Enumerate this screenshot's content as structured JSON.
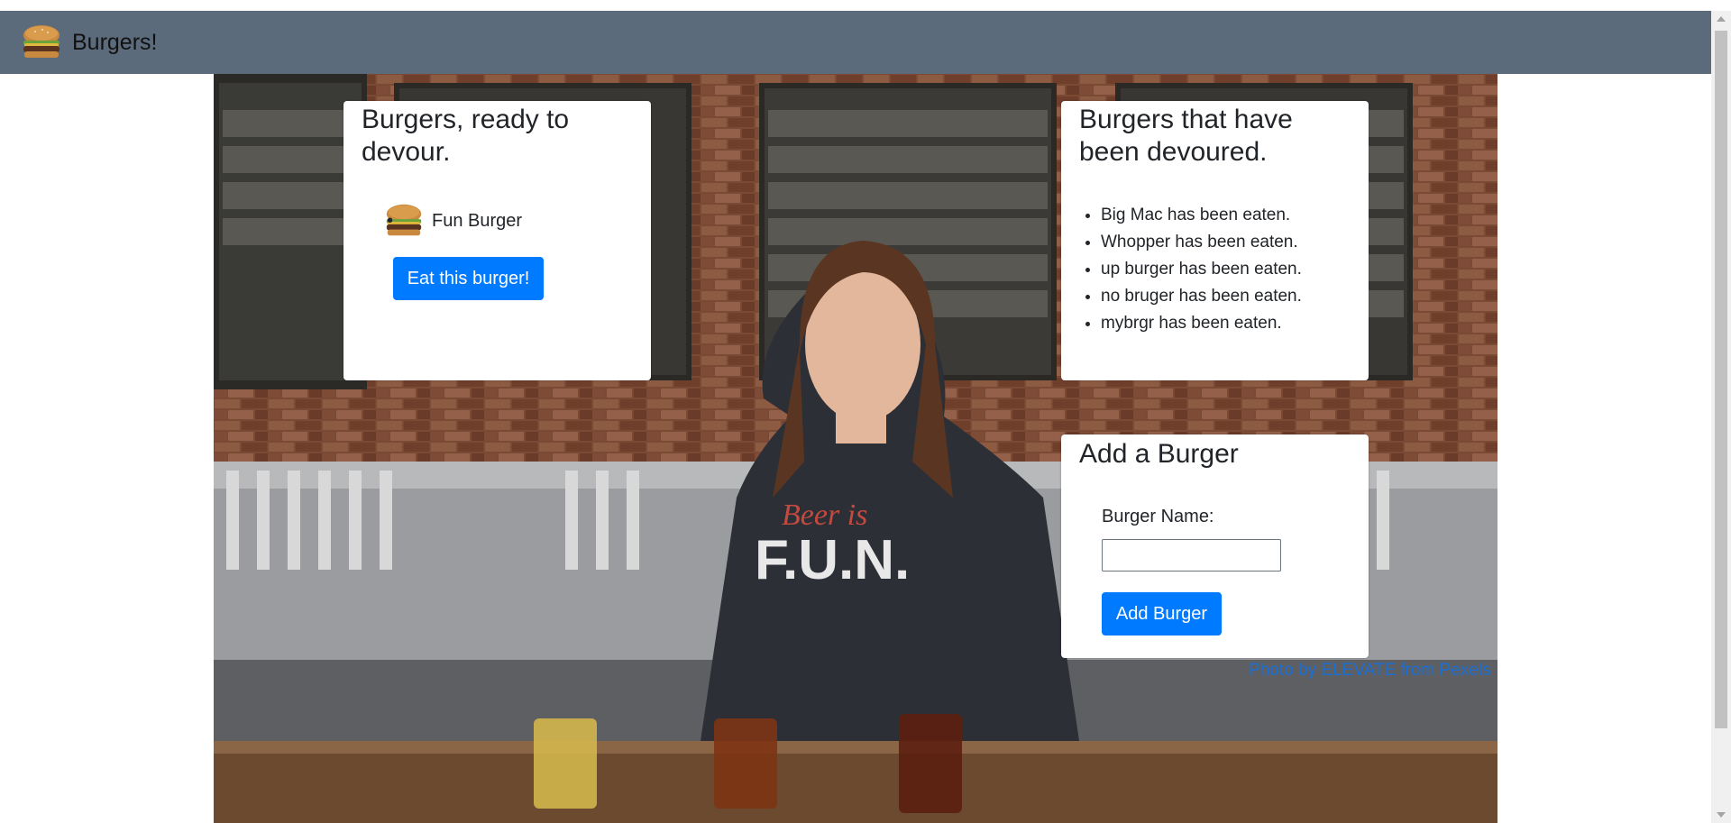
{
  "app": {
    "title": "Burgers!",
    "logo_icon": "burger-icon"
  },
  "ready": {
    "heading": "Burgers, ready to devour.",
    "items": [
      {
        "name": "Fun Burger",
        "icon": "burger-icon"
      }
    ],
    "eat_button": "Eat this burger!"
  },
  "devoured": {
    "heading": "Burgers that have been devoured.",
    "items": [
      "Big Mac has been eaten.",
      "Whopper has been eaten.",
      "up burger has been eaten.",
      "no bruger has been eaten.",
      "mybrgr has been eaten."
    ]
  },
  "add": {
    "heading": "Add a Burger",
    "label": "Burger Name:",
    "input_value": "",
    "button": "Add Burger"
  },
  "credit": "Photo by ELEVATE from Pexels",
  "colors": {
    "navbar": "#5b6b7c",
    "primary": "#007bff",
    "link": "#1a6fd6"
  }
}
